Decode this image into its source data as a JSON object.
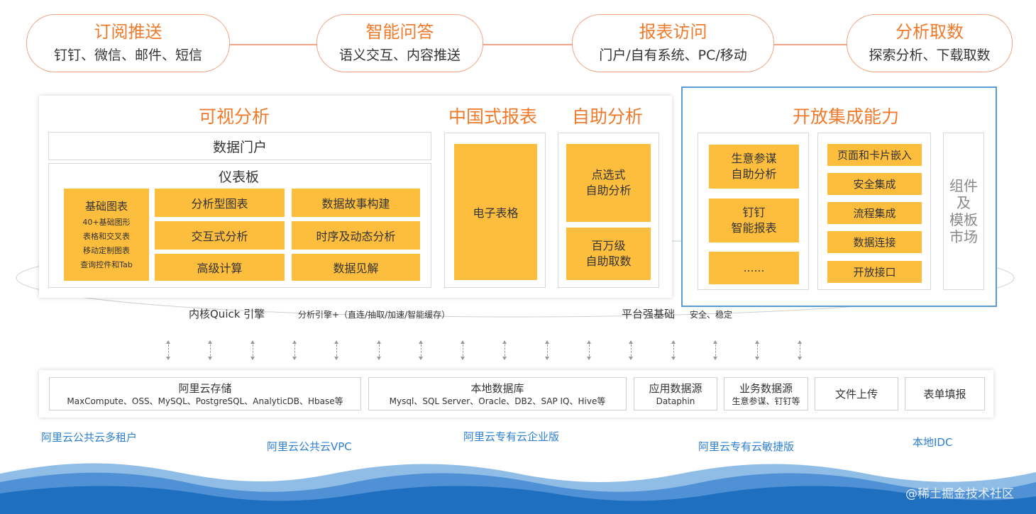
{
  "top_capabilities": [
    {
      "title": "订阅推送",
      "subtitle": "钉钉、微信、邮件、短信"
    },
    {
      "title": "智能问答",
      "subtitle": "语义交互、内容推送"
    },
    {
      "title": "报表访问",
      "subtitle": "门户/自有系统、PC/移动"
    },
    {
      "title": "分析取数",
      "subtitle": "探索分析、下载取数"
    }
  ],
  "visual_analysis": {
    "title": "可视分析",
    "portal": "数据门户",
    "dashboard": "仪表板",
    "basic_chart": {
      "title": "基础图表",
      "lines": [
        "40+基础图形",
        "表格和交叉表",
        "移动定制图表",
        "查询控件和Tab"
      ]
    },
    "cells": [
      "分析型图表",
      "数据故事构建",
      "交互式分析",
      "时序及动态分析",
      "高级计算",
      "数据见解"
    ]
  },
  "china_report": {
    "title": "中国式报表",
    "item": "电子表格"
  },
  "self_analysis": {
    "title": "自助分析",
    "items": [
      "点选式\n自助分析",
      "百万级\n自助取数"
    ]
  },
  "open_integration": {
    "title": "开放集成能力",
    "left_items": [
      "生意参谋\n自助分析",
      "钉钉\n智能报表",
      "……"
    ],
    "right_items": [
      "页面和卡片嵌入",
      "安全集成",
      "流程集成",
      "数据连接",
      "开放接口"
    ],
    "side": "组件\n及\n模板\n市场"
  },
  "engine": {
    "core": "内核Quick 引擎",
    "core_desc": "分析引擎+（直连/抽取/加速/智能缓存）",
    "platform": "平台强基础",
    "platform_desc": "安全、稳定"
  },
  "data_sources": [
    {
      "name": "阿里云存储",
      "desc": "MaxCompute、OSS、MySQL、PostgreSQL、AnalyticDB、Hbase等"
    },
    {
      "name": "本地数据库",
      "desc": "Mysql、SQL Server、Oracle、DB2、SAP IQ、Hive等"
    },
    {
      "name": "应用数据源",
      "desc": "Dataphin"
    },
    {
      "name": "业务数据源",
      "desc": "生意参谋、钉钉等"
    },
    {
      "name": "文件上传",
      "desc": ""
    },
    {
      "name": "表单填报",
      "desc": ""
    }
  ],
  "deployments": [
    "阿里云公共云多租户",
    "阿里云公共云VPC",
    "阿里云专有云企业版",
    "阿里云专有云敏捷版",
    "本地IDC"
  ],
  "watermark": "@稀土掘金技术社区",
  "colors": {
    "accent": "#f07a2b",
    "box_fill": "#fdbe3d",
    "integration_border": "#5b9bd5",
    "deploy_text": "#2d7fd3",
    "wave": "#1f6fc0"
  }
}
